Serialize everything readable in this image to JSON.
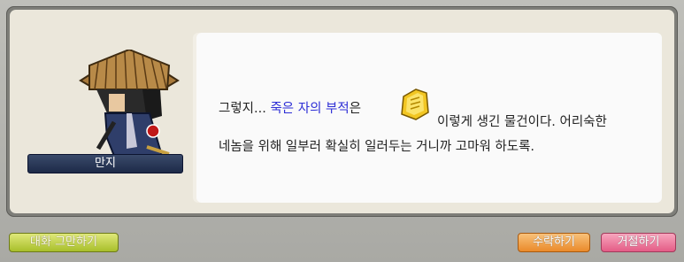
{
  "npc": {
    "name": "만지"
  },
  "dialog": {
    "prefix": "그렇지... ",
    "item_name": "죽은 자의 부적",
    "particle": "은",
    "after_icon": "이렇게 생긴 물건이다. 어리숙한",
    "line2": "네놈을 위해 일부러 확실히 일러두는 거니까 고마워 하도록.",
    "item_icon": "yellow-talisman-icon"
  },
  "buttons": {
    "quit_label": "대화 그만하기",
    "accept_label": "수락하기",
    "decline_label": "거절하기"
  },
  "colors": {
    "item_text": "#2e2fd6",
    "quit": "#b9cb3a",
    "accept": "#f0a04a",
    "decline": "#ec7a9c"
  }
}
